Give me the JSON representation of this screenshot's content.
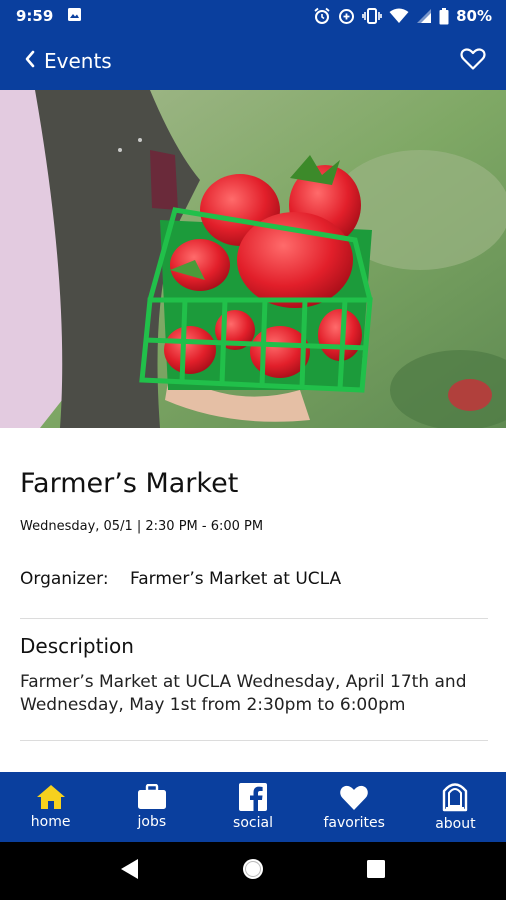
{
  "status_bar": {
    "time": "9:59",
    "battery": "80%",
    "icons": [
      "image-icon",
      "alarm-icon",
      "data-saver-icon",
      "vibrate-icon",
      "wifi-icon",
      "signal-icon",
      "battery-icon"
    ]
  },
  "app_bar": {
    "back_label": "Events",
    "back_icon": "chevron-left-icon",
    "favorite_icon": "heart-outline-icon"
  },
  "hero": {
    "image_subject": "strawberries-in-basket-photo"
  },
  "event": {
    "title": "Farmer’s Market",
    "datetime": "Wednesday, 05/1 | 2:30 PM - 6:00 PM",
    "organizer_label": "Organizer:",
    "organizer_value": "Farmer’s Market at UCLA",
    "description_heading": "Description",
    "description_text": "Farmer’s Market at UCLA Wednesday, April 17th and Wednesday, May 1st from 2:30pm to 6:00pm"
  },
  "bottom_nav": {
    "items": [
      {
        "label": "home",
        "icon": "home-icon",
        "active": true
      },
      {
        "label": "jobs",
        "icon": "briefcase-icon"
      },
      {
        "label": "social",
        "icon": "facebook-icon"
      },
      {
        "label": "favorites",
        "icon": "heart-icon"
      },
      {
        "label": "about",
        "icon": "about-icon"
      }
    ]
  },
  "colors": {
    "brand_blue": "#0a3f9e",
    "active_icon": "#f6d11e",
    "text": "#111111",
    "divider": "#dcdcdc"
  }
}
